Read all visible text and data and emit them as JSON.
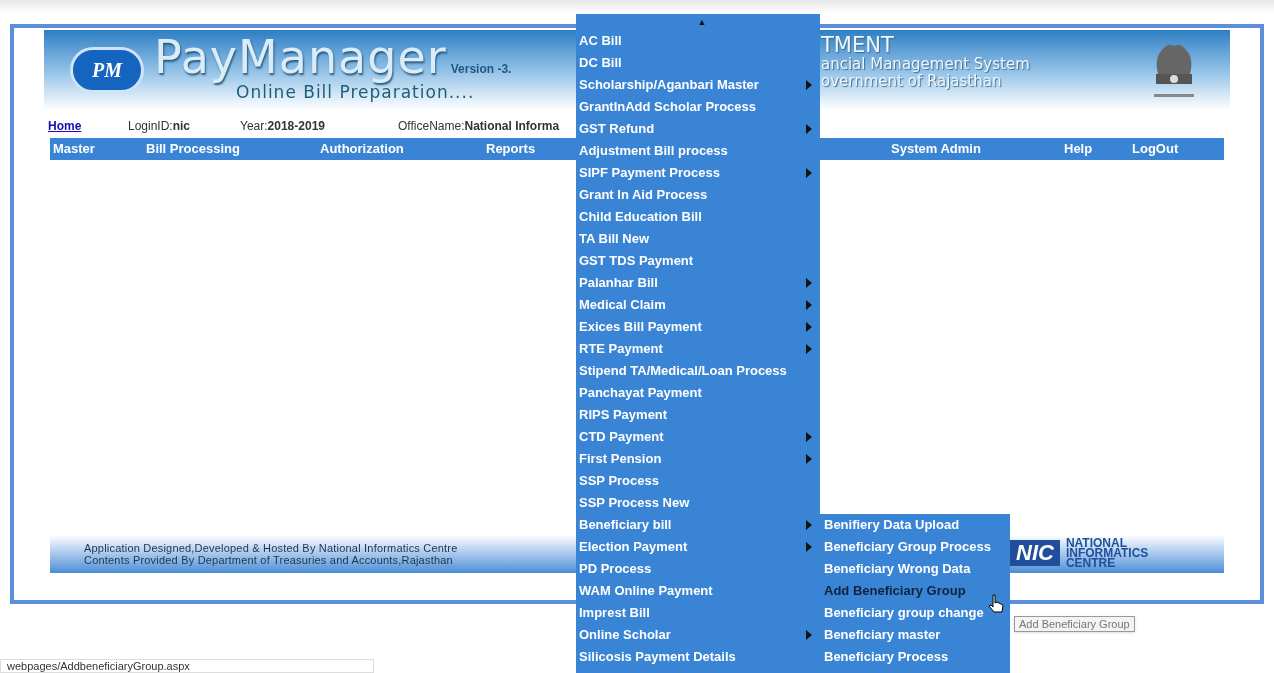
{
  "header": {
    "logo_text": "PM",
    "title": "PayManager",
    "version": "Version -3.",
    "subtitle": "Online Bill Preparation....",
    "dept_title": "TMENT",
    "dept_line1": "ancial Management System",
    "dept_line2": "overnment of Rajasthan"
  },
  "info_bar": {
    "home_link": "Home",
    "login_label": "LoginID:",
    "login_value": "nic",
    "year_label": "Year:",
    "year_value": "2018-2019",
    "office_label": "OfficeName:",
    "office_value": "National Informa"
  },
  "nav_left": [
    "Master",
    "Bill Processing",
    "Authorization",
    "Reports"
  ],
  "nav_right": [
    "System Admin",
    "Help",
    "LogOut"
  ],
  "footer": {
    "line1": "Application Designed,Developed & Hosted By National Informatics Centre",
    "line2": "Contents Provided By Department of  Treasuries and Accounts,Rajasthan",
    "nic_mark": "NIC",
    "nic_name": [
      "NATIONAL",
      "INFORMATICS",
      "CENTRE"
    ]
  },
  "menu": {
    "scroll_up": "▲",
    "items": [
      {
        "label": "AC Bill",
        "has_submenu": false
      },
      {
        "label": "DC Bill",
        "has_submenu": false
      },
      {
        "label": "Scholarship/Aganbari Master",
        "has_submenu": true
      },
      {
        "label": "GrantInAdd Scholar Process",
        "has_submenu": false
      },
      {
        "label": "GST Refund",
        "has_submenu": true
      },
      {
        "label": "Adjustment Bill process",
        "has_submenu": false
      },
      {
        "label": "SIPF Payment Process",
        "has_submenu": true
      },
      {
        "label": "Grant In Aid Process",
        "has_submenu": false
      },
      {
        "label": "Child Education Bill",
        "has_submenu": false
      },
      {
        "label": "TA Bill New",
        "has_submenu": false
      },
      {
        "label": "GST TDS Payment",
        "has_submenu": false
      },
      {
        "label": "Palanhar Bill",
        "has_submenu": true
      },
      {
        "label": "Medical Claim",
        "has_submenu": true
      },
      {
        "label": "Exices Bill Payment",
        "has_submenu": true
      },
      {
        "label": "RTE Payment",
        "has_submenu": true
      },
      {
        "label": "Stipend TA/Medical/Loan Process",
        "has_submenu": false
      },
      {
        "label": "Panchayat Payment",
        "has_submenu": false
      },
      {
        "label": "RIPS Payment",
        "has_submenu": false
      },
      {
        "label": "CTD Payment",
        "has_submenu": true
      },
      {
        "label": "First Pension",
        "has_submenu": true
      },
      {
        "label": "SSP Process",
        "has_submenu": false
      },
      {
        "label": "SSP Process New",
        "has_submenu": false
      },
      {
        "label": "Beneficiary bill",
        "has_submenu": true
      },
      {
        "label": "Election Payment",
        "has_submenu": true
      },
      {
        "label": "PD Process",
        "has_submenu": false
      },
      {
        "label": "WAM Online Payment",
        "has_submenu": false
      },
      {
        "label": "Imprest Bill",
        "has_submenu": false
      },
      {
        "label": "Online Scholar",
        "has_submenu": true
      },
      {
        "label": "Silicosis Payment Details",
        "has_submenu": false
      }
    ]
  },
  "submenu": {
    "items": [
      {
        "label": "Benifiery Data Upload",
        "selected": false
      },
      {
        "label": "Beneficiary Group Process",
        "selected": false
      },
      {
        "label": "Beneficiary Wrong Data",
        "selected": false
      },
      {
        "label": "Add Beneficiary Group",
        "selected": true
      },
      {
        "label": "Beneficiary group change",
        "selected": false
      },
      {
        "label": "Beneficiary master",
        "selected": false
      },
      {
        "label": "Beneficiary Process",
        "selected": false
      }
    ]
  },
  "tooltip": "Add Beneficiary Group",
  "status_url": "webpages/AddbeneficiaryGroup.aspx"
}
